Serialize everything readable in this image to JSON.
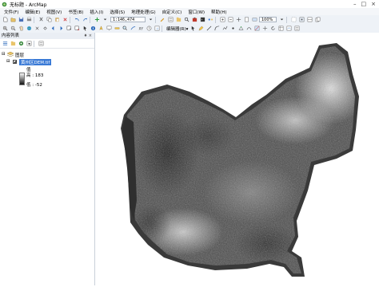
{
  "window": {
    "title": "无标题 - ArcMap"
  },
  "menu": {
    "items": [
      "文件(F)",
      "编辑(E)",
      "视图(V)",
      "书签(B)",
      "插入(I)",
      "选择(S)",
      "地理处理(G)",
      "自定义(C)",
      "窗口(W)",
      "帮助(H)"
    ]
  },
  "toolbar": {
    "scale_value": "1:146,474",
    "zoom_value": "100%",
    "editor_label": "编辑器(R)▾"
  },
  "toc": {
    "title": "内容列表",
    "pin": "♦ ×",
    "group_label": "图层",
    "layer_name": "黄州区DEM.tif",
    "legend_title": "值",
    "high_label": "高 : 183",
    "low_label": "低 : -52"
  },
  "colors": {
    "toolbar_bg": "#eef2f7",
    "selection": "#3a7ad6",
    "dem_dark": "#2a2a2a",
    "dem_light": "#e0e0e0"
  }
}
